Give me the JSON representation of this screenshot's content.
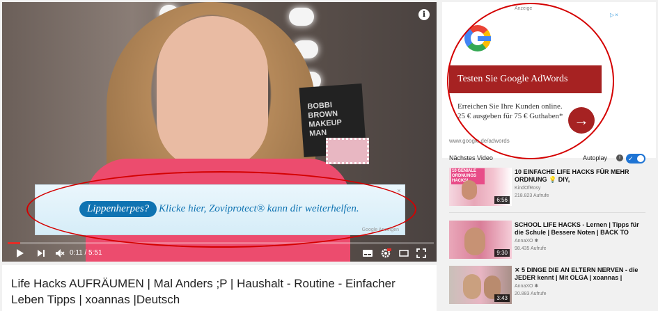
{
  "video": {
    "info_icon": "i",
    "overlay_ad": {
      "pill": "Lippenherpes?",
      "text": "Klicke hier, Zoviprotect® kann dir weiterhelfen.",
      "close": "×",
      "attribution": "Google Anzeigen"
    },
    "product_box_text": "BOBBI BROWN MAKEUP MAN",
    "progress_fraction": 0.03,
    "time": "0:11 / 5:51",
    "title": "Life Hacks AUFRÄUMEN | Mal Anders ;P | Haushalt - Routine - Einfacher Leben Tipps | xoannas |Deutsch"
  },
  "sidebar_ad": {
    "label": "Anzeige",
    "ad_choices": "▷×",
    "headline": "Testen Sie Google AdWords",
    "body": "Erreichen Sie Ihre Kunden online. 25 € ausgeben für 75 € Guthaben*",
    "url": "www.google.de/adwords",
    "arrow": "→"
  },
  "next": {
    "heading": "Nächstes Video",
    "autoplay_label": "Autoplay",
    "autoplay_on": true,
    "info": "i"
  },
  "videos": [
    {
      "title": "10 EINFACHE LIFE HACKS FÜR MEHR ORDNUNG 💡 DIY,",
      "channel": "KindOfRosy",
      "views": "218.823 Aufrufe",
      "duration": "6:56",
      "thumb_text": "10 GENIALE ORDNUNGS HACKS!"
    },
    {
      "title": "SCHOOL LIFE HACKS - Lernen | Tipps für die Schule | Bessere Noten | BACK TO",
      "channel": "AnnaXO ✱",
      "views": "98.435 Aufrufe",
      "duration": "9:30",
      "thumb_text": ""
    },
    {
      "title": "✕ 5 DINGE DIE AN ELTERN NERVEN - die JEDER kennt | Mit OLGA | xoannas |",
      "channel": "AnnaXO ✱",
      "views": "20.883 Aufrufe",
      "duration": "3:43",
      "thumb_text": ""
    }
  ]
}
